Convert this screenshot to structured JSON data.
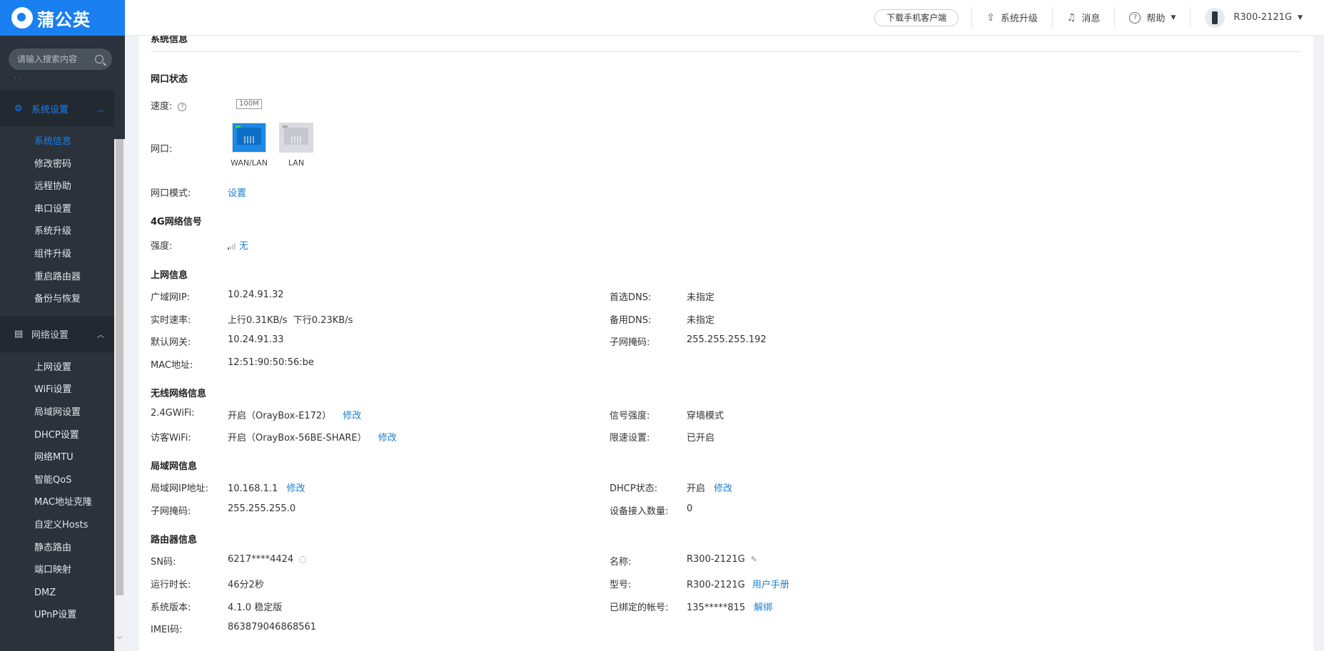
{
  "brand": {
    "name": "蒲公英"
  },
  "search": {
    "placeholder": "请输入搜索内容"
  },
  "sidebar": {
    "group_system": {
      "label": "系统设置"
    },
    "system_items": [
      "系统信息",
      "修改密码",
      "远程协助",
      "串口设置",
      "系统升级",
      "组件升级",
      "重启路由器",
      "备份与恢复"
    ],
    "group_network": {
      "label": "网络设置"
    },
    "network_items": [
      "上网设置",
      "WiFi设置",
      "局域网设置",
      "DHCP设置",
      "网络MTU",
      "智能QoS",
      "MAC地址克隆",
      "自定义Hosts",
      "静态路由",
      "端口映射",
      "DMZ",
      "UPnP设置"
    ]
  },
  "topbar": {
    "download": "下载手机客户端",
    "upgrade": "系统升级",
    "messages": "消息",
    "help": "帮助",
    "device": "R300-2121G"
  },
  "page": {
    "title": "系统信息",
    "port_status": {
      "heading": "网口状态",
      "speed_label": "速度:",
      "speed_value": "100M",
      "port_label": "网口:",
      "ports": [
        "WAN/LAN",
        "LAN"
      ],
      "mode_label": "网口模式:",
      "mode_link": "设置"
    },
    "signal_4g": {
      "heading": "4G网络信号",
      "strength_label": "强度:",
      "strength_value": "无"
    },
    "internet": {
      "heading": "上网信息",
      "wan_ip_label": "广域网IP:",
      "wan_ip": "10.24.91.32",
      "rate_label": "实时速率:",
      "rate": "上行0.31KB/s  下行0.23KB/s",
      "gateway_label": "默认网关:",
      "gateway": "10.24.91.33",
      "mac_label": "MAC地址:",
      "mac": "12:51:90:50:56:be",
      "dns1_label": "首选DNS:",
      "dns1": "未指定",
      "dns2_label": "备用DNS:",
      "dns2": "未指定",
      "mask_label": "子网掩码:",
      "mask": "255.255.255.192"
    },
    "wireless": {
      "heading": "无线网络信息",
      "wifi24_label": "2.4GWiFi:",
      "wifi24": "开启（OrayBox-E172）",
      "wifi24_edit": "修改",
      "guest_label": "访客WiFi:",
      "guest": "开启（OrayBox-56BE-SHARE）",
      "guest_edit": "修改",
      "signal_label": "信号强度:",
      "signal": "穿墙模式",
      "limit_label": "限速设置:",
      "limit": "已开启"
    },
    "lan": {
      "heading": "局域网信息",
      "ip_label": "局域网IP地址:",
      "ip": "10.168.1.1",
      "ip_edit": "修改",
      "mask_label": "子网掩码:",
      "mask": "255.255.255.0",
      "dhcp_label": "DHCP状态:",
      "dhcp": "开启",
      "dhcp_edit": "修改",
      "devices_label": "设备接入数量:",
      "devices": "0"
    },
    "router": {
      "heading": "路由器信息",
      "sn_label": "SN码:",
      "sn": "6217****4424",
      "uptime_label": "运行时长:",
      "uptime": "46分2秒",
      "version_label": "系统版本:",
      "version": "4.1.0 稳定版",
      "imei_label": "IMEI码:",
      "imei": "863879046868561",
      "name_label": "名称:",
      "name": "R300-2121G",
      "model_label": "型号:",
      "model": "R300-2121G",
      "manual": "用户手册",
      "account_label": "已绑定的帐号:",
      "account": "135*****815",
      "unbind": "解绑"
    }
  }
}
